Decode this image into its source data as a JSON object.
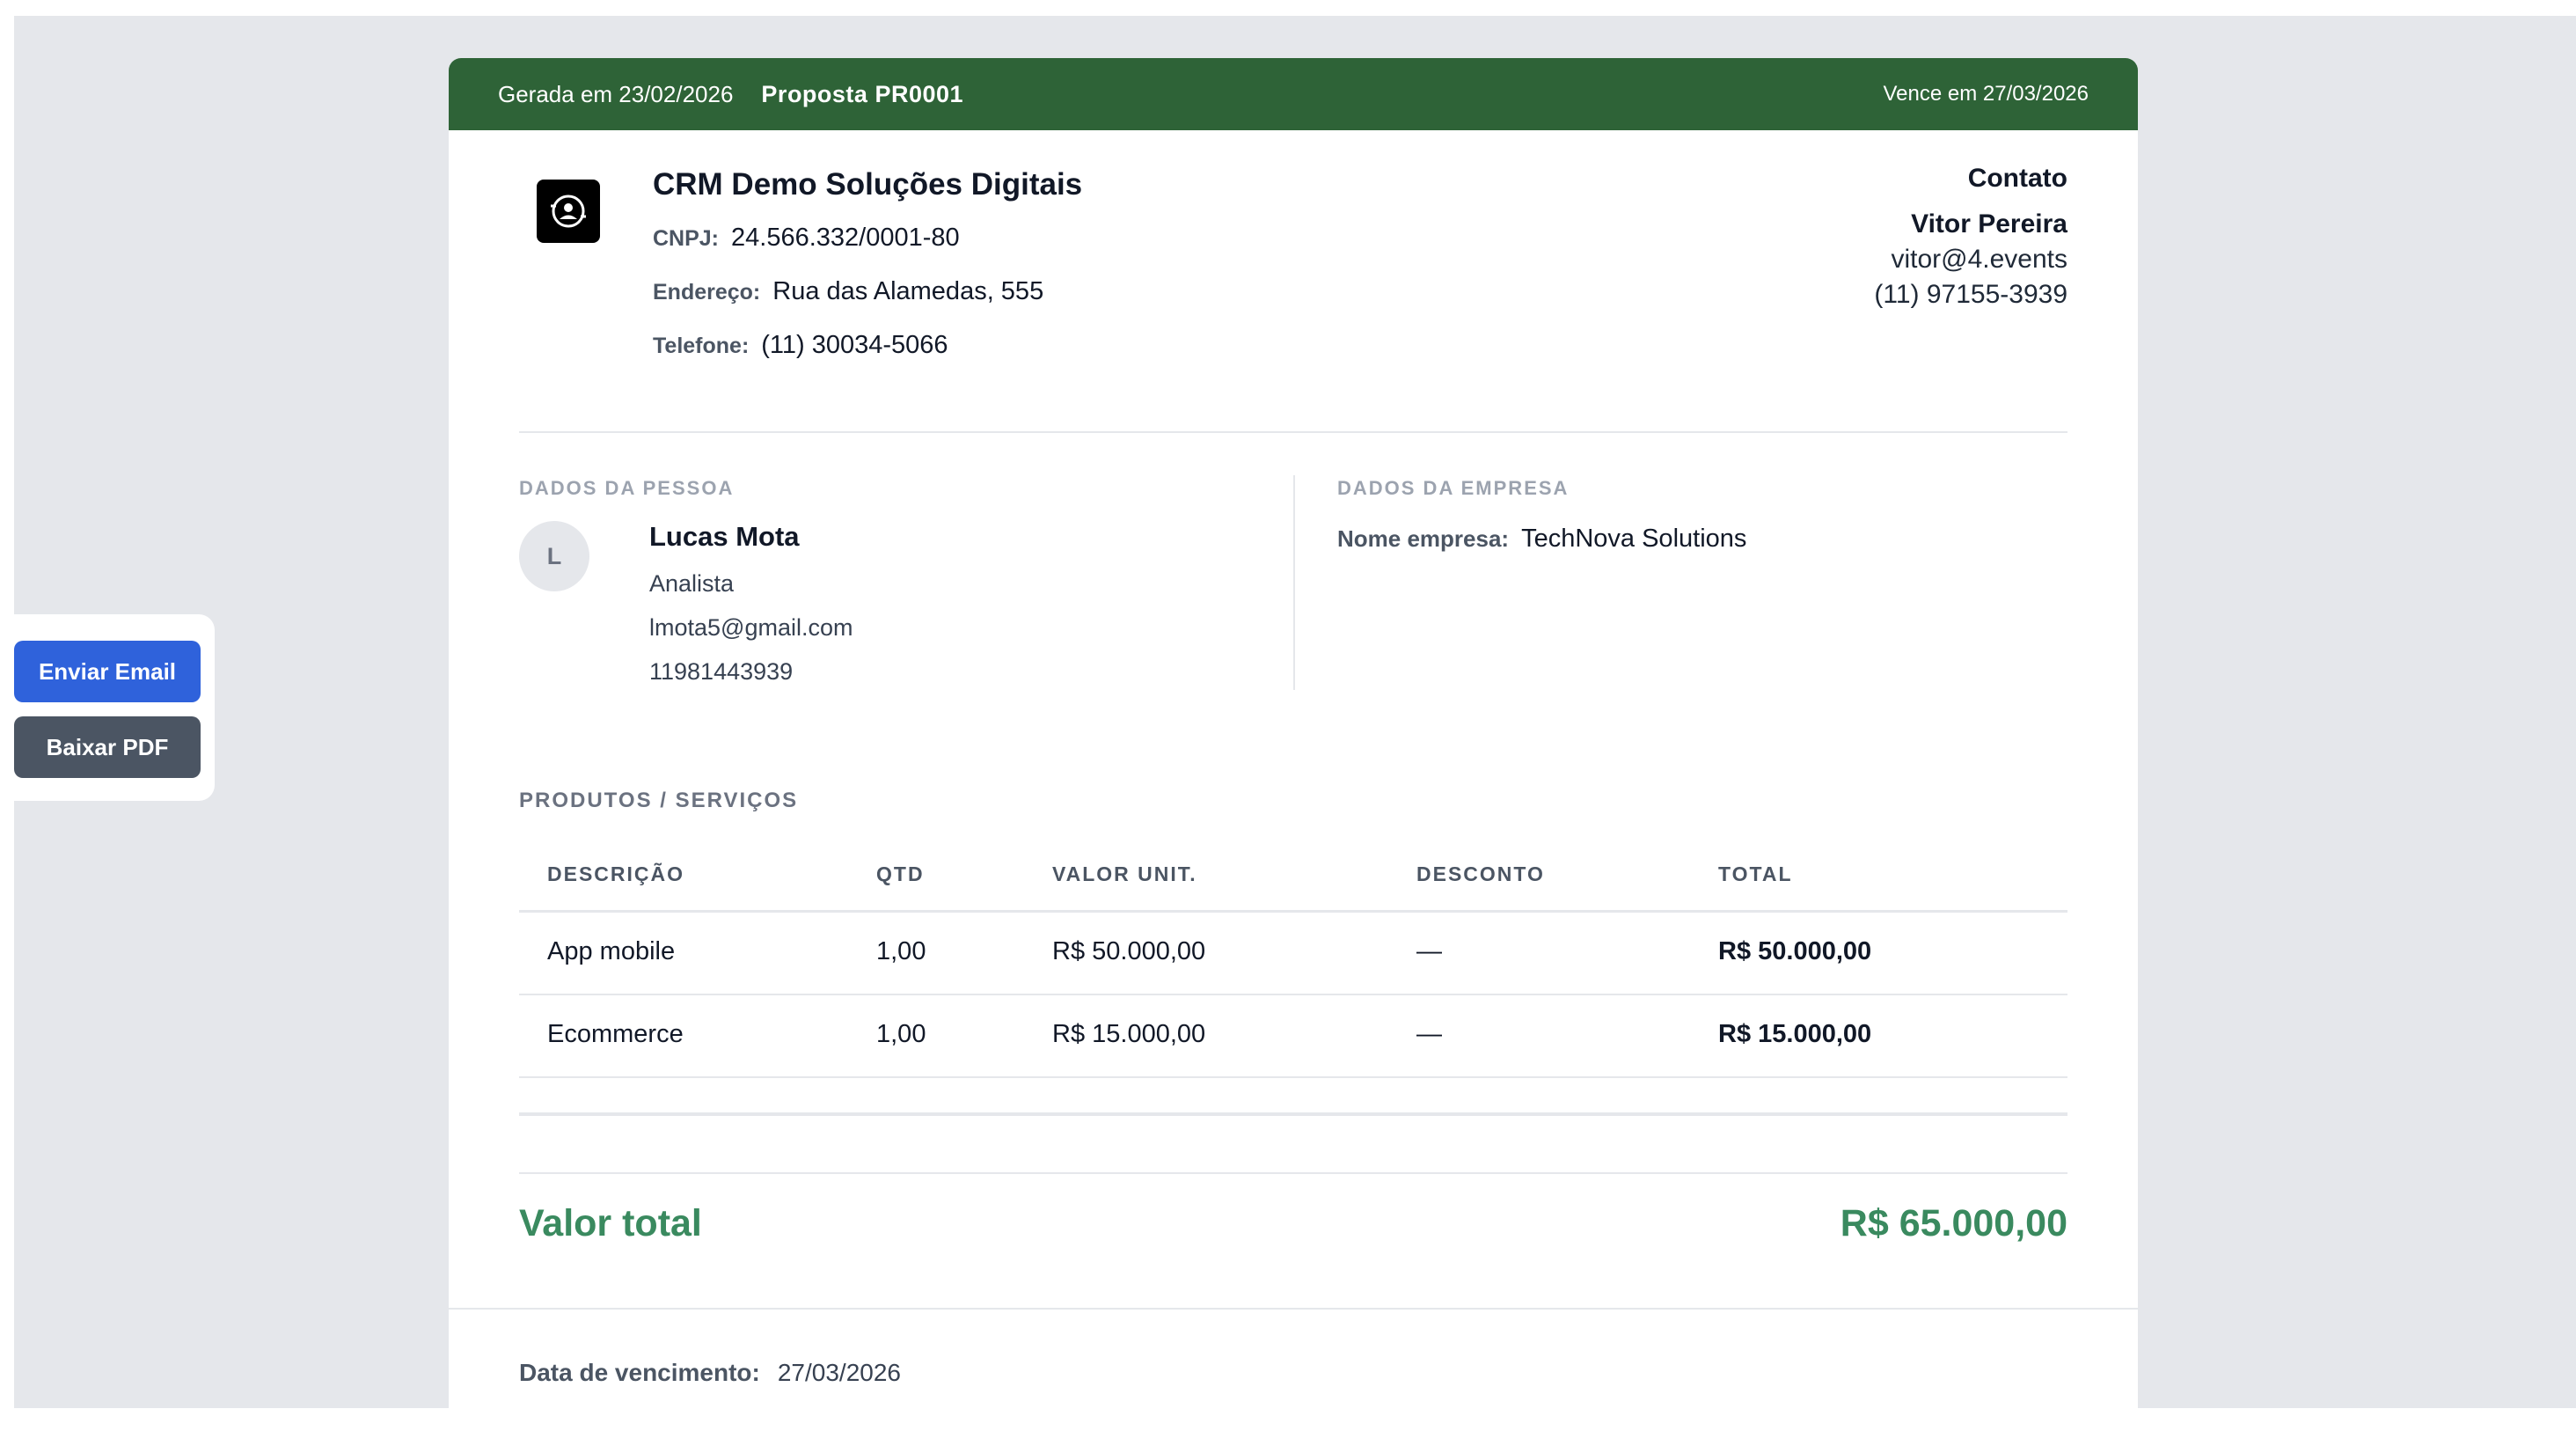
{
  "header": {
    "generated": "Gerada em 23/02/2026",
    "proposal": "Proposta PR0001",
    "due": "Vence em 27/03/2026",
    "color": "#2e6337"
  },
  "company": {
    "logo_icon": "company-logo-icon",
    "name": "CRM Demo Soluções Digitais",
    "cnpj_label": "CNPJ:",
    "cnpj": "24.566.332/0001-80",
    "address_label": "Endereço:",
    "address": "Rua das Alamedas, 555",
    "phone_label": "Telefone:",
    "phone": "(11) 30034-5066"
  },
  "contact": {
    "heading": "Contato",
    "name": "Vitor Pereira",
    "email": "vitor@4.events",
    "phone": "(11) 97155-3939"
  },
  "person": {
    "section_label": "DADOS DA PESSOA",
    "initial": "L",
    "name": "Lucas Mota",
    "role": "Analista",
    "email": "lmota5@gmail.com",
    "phone": "11981443939"
  },
  "business": {
    "section_label": "DADOS DA EMPRESA",
    "name_label": "Nome empresa:",
    "name": "TechNova Solutions"
  },
  "products": {
    "section_label": "PRODUTOS / SERVIÇOS",
    "columns": [
      "DESCRIÇÃO",
      "QTD",
      "VALOR UNIT.",
      "DESCONTO",
      "TOTAL"
    ],
    "rows": [
      [
        "App mobile",
        "1,00",
        "R$ 50.000,00",
        "—",
        "R$ 50.000,00"
      ],
      [
        "Ecommerce",
        "1,00",
        "R$ 15.000,00",
        "—",
        "R$ 15.000,00"
      ]
    ]
  },
  "total": {
    "label": "Valor total",
    "value": "R$ 65.000,00",
    "color": "#3a8a5f"
  },
  "footer": {
    "due_label": "Data de vencimento:",
    "due_value": "27/03/2026"
  },
  "actions": {
    "send_email": "Enviar Email",
    "download_pdf": "Baixar PDF",
    "email_color": "#2f62db",
    "pdf_color": "#4b5563"
  }
}
